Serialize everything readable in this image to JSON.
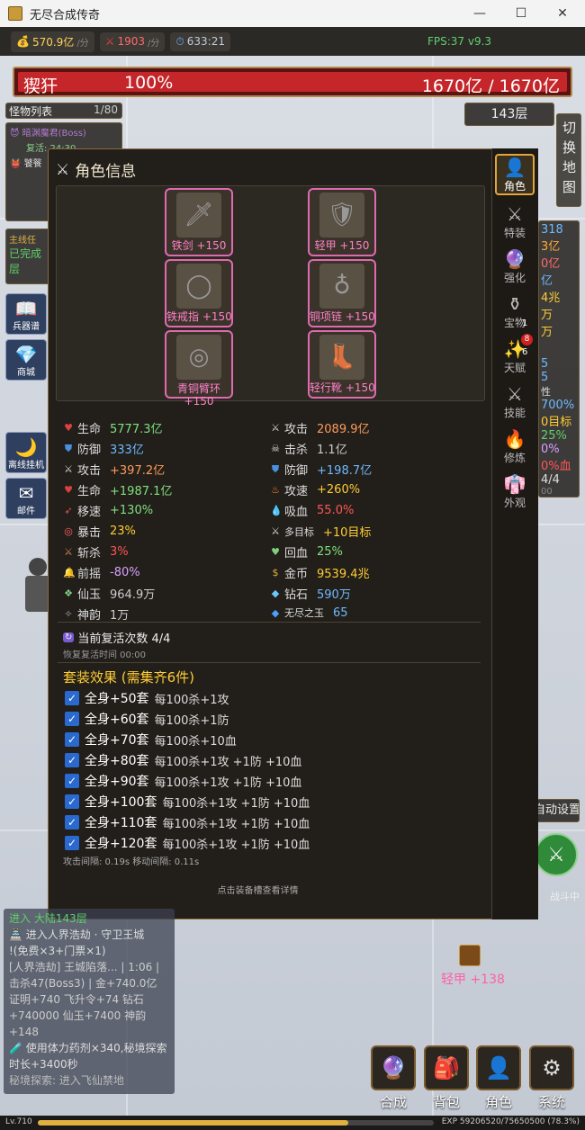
{
  "window": {
    "title": "无尽合成传奇",
    "min": "—",
    "max": "☐",
    "close": "✕"
  },
  "topbar": {
    "gold": "570.9亿",
    "gold_unit": "/分",
    "kill": "1903",
    "kill_unit": "/分",
    "timer": "633:21",
    "fps": "FPS:37 v9.3"
  },
  "boss": {
    "name": "猰犴",
    "hp_pct": "100%",
    "hp_text": "1670亿 / 1670亿"
  },
  "monster_list": {
    "title": "怪物列表",
    "count": "1/80",
    "boss_name": "暗渊魔君(Boss)",
    "revive": "复活: 24:30",
    "second": "饕餮"
  },
  "floor": "143层",
  "switch_map": "切换地图",
  "quest": {
    "label": "主线任",
    "done": "已完成",
    "rest": "层"
  },
  "left_buttons": [
    "兵器谱",
    "商城",
    "离线挂机",
    "邮件"
  ],
  "modal": {
    "title": "角色信息",
    "close": "X",
    "equipment": [
      {
        "name": "铁剑 +150",
        "icon": "sword-icon",
        "glyph": "🗡"
      },
      {
        "name": "轻甲 +150",
        "icon": "armor-icon",
        "glyph": "🛡"
      },
      {
        "name": "铁戒指 +150",
        "icon": "ring-icon",
        "glyph": "◯"
      },
      {
        "name": "铜项链 +150",
        "icon": "necklace-icon",
        "glyph": "♁"
      },
      {
        "name": "青铜臂环 +150",
        "icon": "bracer-icon",
        "glyph": "◎"
      },
      {
        "name": "轻行靴 +150",
        "icon": "boots-icon",
        "glyph": "👢"
      }
    ],
    "stats_left": [
      {
        "icon": "heart-icon",
        "glyph": "♥",
        "color": "#e04040",
        "key": "生命",
        "val": "5777.3亿",
        "vc": "#7fe07f"
      },
      {
        "icon": "shield-icon",
        "glyph": "⛊",
        "color": "#4a90e0",
        "key": "防御",
        "val": "333亿",
        "vc": "#6fb8ff"
      },
      {
        "icon": "swords-icon",
        "glyph": "⚔",
        "color": "#ddd",
        "key": "攻击",
        "val": "+397.2亿",
        "vc": "#ff9a5a"
      },
      {
        "icon": "heart-icon",
        "glyph": "♥",
        "color": "#e04040",
        "key": "生命",
        "val": "+1987.1亿",
        "vc": "#7fe07f"
      },
      {
        "icon": "feather-icon",
        "glyph": "➶",
        "color": "#e05050",
        "key": "移速",
        "val": "+130%",
        "vc": "#7fe07f"
      },
      {
        "icon": "target-icon",
        "glyph": "◎",
        "color": "#ff6060",
        "key": "暴击",
        "val": "23%",
        "vc": "#ffcc33"
      },
      {
        "icon": "blade-icon",
        "glyph": "⚔",
        "color": "#e08050",
        "key": "斩杀",
        "val": "3%",
        "vc": "#ff5555"
      },
      {
        "icon": "bell-icon",
        "glyph": "🔔",
        "color": "#ffaa33",
        "key": "前摇",
        "val": "-80%",
        "vc": "#d9a0ff"
      },
      {
        "icon": "jade-icon",
        "glyph": "❖",
        "color": "#7fd07f",
        "key": "仙玉",
        "val": "964.9万",
        "vc": "#ccc"
      },
      {
        "icon": "charm-icon",
        "glyph": "✧",
        "color": "#aaa",
        "key": "神韵",
        "val": "1万",
        "vc": "#ccc"
      }
    ],
    "stats_right": [
      {
        "icon": "swords-icon",
        "glyph": "⚔",
        "color": "#ddd",
        "key": "攻击",
        "val": "2089.9亿",
        "vc": "#ff9a5a"
      },
      {
        "icon": "skull-icon",
        "glyph": "☠",
        "color": "#ddd",
        "key": "击杀",
        "val": "1.1亿",
        "vc": "#ccc"
      },
      {
        "icon": "shield-icon",
        "glyph": "⛊",
        "color": "#4a90e0",
        "key": "防御",
        "val": "+198.7亿",
        "vc": "#6fb8ff"
      },
      {
        "icon": "fire-icon",
        "glyph": "♨",
        "color": "#ff8a30",
        "key": "攻速",
        "val": "+260%",
        "vc": "#ffcc33"
      },
      {
        "icon": "drop-icon",
        "glyph": "💧",
        "color": "#e03030",
        "key": "吸血",
        "val": "55.0%",
        "vc": "#ff5555"
      },
      {
        "icon": "swords-icon",
        "glyph": "⚔",
        "color": "#ddd",
        "key": "多目标",
        "val": "+10目标",
        "vc": "#ffcc33"
      },
      {
        "icon": "heart-icon",
        "glyph": "♥",
        "color": "#7fd07f",
        "key": "回血",
        "val": "25%",
        "vc": "#7fe07f"
      },
      {
        "icon": "moneybag-icon",
        "glyph": "$",
        "color": "#e0b040",
        "key": "金币",
        "val": "9539.4兆",
        "vc": "#ffcc33"
      },
      {
        "icon": "diamond-icon",
        "glyph": "◆",
        "color": "#6ac8ff",
        "key": "钻石",
        "val": "590万",
        "vc": "#6fb8ff"
      },
      {
        "icon": "gem-icon",
        "glyph": "◆",
        "color": "#4aa0ff",
        "key": "无尽之玉",
        "val": "65",
        "vc": "#6fb8ff"
      }
    ],
    "revive": {
      "label": "当前复活次数 4/4",
      "time": "恢复复活时间 00:00"
    },
    "set_title": "套装效果 (需集齐6件)",
    "sets": [
      {
        "name": "全身+50套",
        "desc": "每100杀+1攻"
      },
      {
        "name": "全身+60套",
        "desc": "每100杀+1防"
      },
      {
        "name": "全身+70套",
        "desc": "每100杀+10血"
      },
      {
        "name": "全身+80套",
        "desc": "每100杀+1攻 +1防 +10血"
      },
      {
        "name": "全身+90套",
        "desc": "每100杀+1攻 +1防 +10血"
      },
      {
        "name": "全身+100套",
        "desc": "每100杀+1攻 +1防 +10血"
      },
      {
        "name": "全身+110套",
        "desc": "每100杀+1攻 +1防 +10血"
      },
      {
        "name": "全身+120套",
        "desc": "每100杀+1攻 +1防 +10血"
      }
    ],
    "intervals": "攻击间隔: 0.19s  移动间隔: 0.11s",
    "hint": "点击装备槽查看详情"
  },
  "side_tabs": [
    {
      "label": "角色",
      "icon": "person-icon",
      "glyph": "👤"
    },
    {
      "label": "特装",
      "icon": "swords-icon",
      "glyph": "⚔"
    },
    {
      "label": "强化",
      "icon": "orb-icon",
      "glyph": "🔮"
    },
    {
      "label": "宝物",
      "icon": "pot-icon",
      "glyph": "⚱"
    },
    {
      "label": "天赋",
      "icon": "sparkle-icon",
      "glyph": "✨"
    },
    {
      "label": "技能",
      "icon": "swords-icon",
      "glyph": "⚔"
    },
    {
      "label": "修炼",
      "icon": "fire-icon",
      "glyph": "🔥"
    },
    {
      "label": "外观",
      "icon": "robe-icon",
      "glyph": "👘"
    }
  ],
  "tab_badges": {
    "treasure": "1",
    "talent_red": "8",
    "talent": "6"
  },
  "right_panel": [
    "318",
    "3亿",
    "0亿",
    "亿",
    "4兆",
    "万",
    "万",
    "5",
    "5",
    "性",
    "700%",
    "0目标",
    "25%",
    "0%",
    "0%血",
    "4/4",
    "00"
  ],
  "right_controls": {
    "settings": "自动设置",
    "battle": "战斗中"
  },
  "log": {
    "l1": "进入 大陆143层",
    "l2": "进入人界浩劫 · 守卫王城",
    "l3": "!(免费×3+门票×1)",
    "l4": "[人界浩劫] 王城陷落... | 1:06 | 击杀47(Boss3) | 金+740.0亿 证明+740 飞升令+74 钻石+740000 仙玉+7400 神韵+148",
    "l5": "使用体力药剂×340,秘境探索时长+3400秒",
    "l6": "秘境探索: 进入飞仙禁地"
  },
  "drop": "轻甲 +138",
  "bottom_buttons": [
    {
      "label": "合成",
      "icon": "orb-icon",
      "glyph": "🔮"
    },
    {
      "label": "背包",
      "icon": "backpack-icon",
      "glyph": "🎒"
    },
    {
      "label": "角色",
      "icon": "person-icon",
      "glyph": "👤"
    },
    {
      "label": "系统",
      "icon": "gear-icon",
      "glyph": "⚙"
    }
  ],
  "status": {
    "level": "Lv.710",
    "exp": "EXP 59206520/75650500 (78.3%)",
    "exp_frac": 0.783
  }
}
